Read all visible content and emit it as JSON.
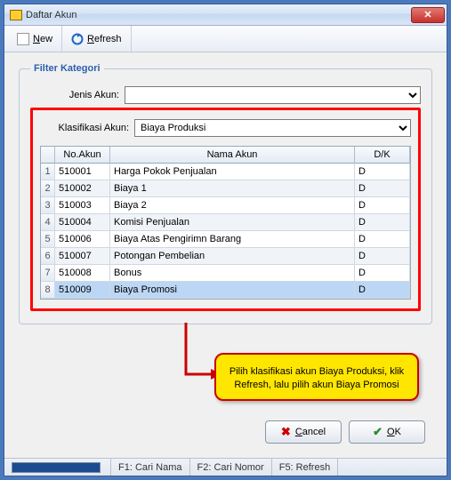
{
  "window": {
    "title": "Daftar Akun"
  },
  "toolbar": {
    "new_label": "New",
    "refresh_label": "Refresh"
  },
  "filter": {
    "group_title": "Filter Kategori",
    "jenis_label": "Jenis Akun:",
    "jenis_value": "",
    "klasifikasi_label": "Klasifikasi Akun:",
    "klasifikasi_value": "Biaya Produksi"
  },
  "grid": {
    "headers": {
      "idx": "",
      "no": "No.Akun",
      "nama": "Nama Akun",
      "dk": "D/K"
    },
    "rows": [
      {
        "idx": "1",
        "no": "510001",
        "nama": "Harga Pokok Penjualan",
        "dk": "D"
      },
      {
        "idx": "2",
        "no": "510002",
        "nama": "Biaya 1",
        "dk": "D"
      },
      {
        "idx": "3",
        "no": "510003",
        "nama": "Biaya 2",
        "dk": "D"
      },
      {
        "idx": "4",
        "no": "510004",
        "nama": "Komisi Penjualan",
        "dk": "D"
      },
      {
        "idx": "5",
        "no": "510006",
        "nama": "Biaya Atas Pengirimn Barang",
        "dk": "D"
      },
      {
        "idx": "6",
        "no": "510007",
        "nama": "Potongan Pembelian",
        "dk": "D"
      },
      {
        "idx": "7",
        "no": "510008",
        "nama": "Bonus",
        "dk": "D"
      },
      {
        "idx": "8",
        "no": "510009",
        "nama": "Biaya Promosi",
        "dk": "D"
      }
    ],
    "selected_index": 7
  },
  "callout": {
    "text": "Pilih klasifikasi akun Biaya Produksi, klik Refresh, lalu pilih akun Biaya Promosi"
  },
  "buttons": {
    "cancel": "Cancel",
    "ok": "OK"
  },
  "statusbar": {
    "f1": "F1: Cari Nama",
    "f2": "F2: Cari Nomor",
    "f5": "F5: Refresh"
  },
  "colors": {
    "highlight": "#ff0000",
    "callout_bg": "#ffe600"
  }
}
